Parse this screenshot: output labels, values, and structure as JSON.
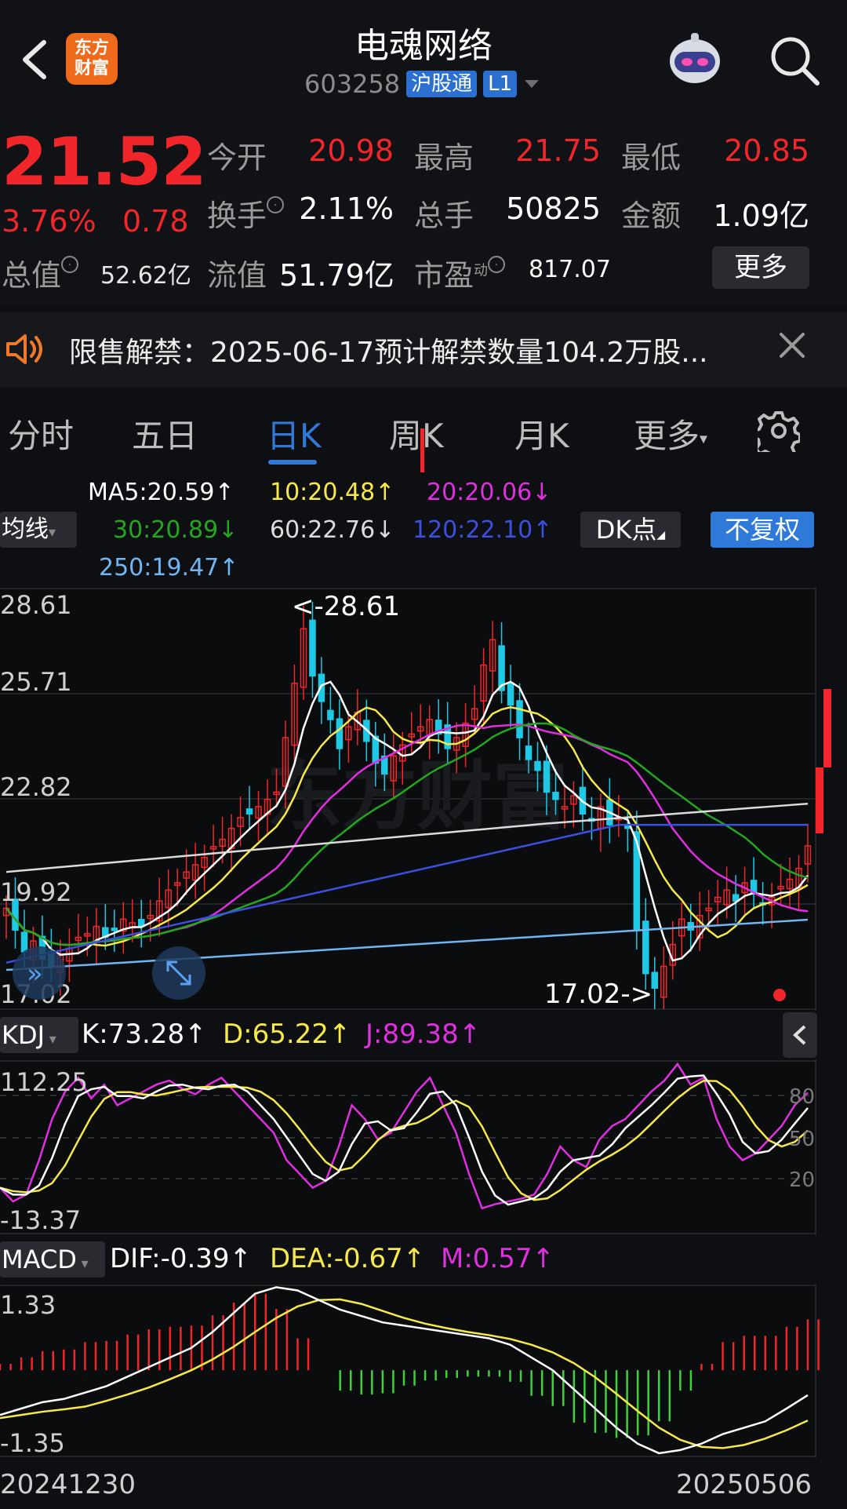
{
  "header": {
    "title": "电魂网络",
    "code": "603258",
    "exchange_tag": "沪股通",
    "level_tag": "L1",
    "logo_text_1": "东方",
    "logo_text_2": "财富"
  },
  "quote": {
    "price": "21.52",
    "change_pct": "3.76%",
    "change_amt": "0.78",
    "open_label": "今开",
    "open": "20.98",
    "high_label": "最高",
    "high": "21.75",
    "low_label": "最低",
    "low": "20.85",
    "turnover_label": "换手",
    "turnover": "2.11%",
    "volume_label": "总手",
    "volume": "50825",
    "amount_label": "金额",
    "amount": "1.09亿",
    "total_mv_label": "总值",
    "total_mv": "52.62亿",
    "float_mv_label": "流值",
    "float_mv": "51.79亿",
    "pe_label": "市盈",
    "pe_sup": "动",
    "pe": "817.07",
    "more_label": "更多"
  },
  "notice": {
    "text": "限售解禁：2025-06-17预计解禁数量104.2万股..."
  },
  "tabs": [
    "分时",
    "五日",
    "日K",
    "周K",
    "月K",
    "更多"
  ],
  "ma": {
    "ma5": "MA5:20.59↑",
    "ma10": "10:20.48↑",
    "ma20": "20:20.06↓",
    "ma30": "30:20.89↓",
    "ma60": "60:22.76↓",
    "ma120": "120:22.10↑",
    "ma250": "250:19.47↑",
    "dropdown": "均线",
    "dk_label": "DK点",
    "fq_label": "不复权"
  },
  "colors": {
    "up": "#f0262a",
    "down": "#1ec9e6",
    "ma5": "#ffffff",
    "ma10": "#f7e94a",
    "ma20": "#e02ee0",
    "ma30": "#23a71e",
    "ma60": "#dcdcdc",
    "ma120": "#3b4fe0",
    "ma250": "#6fb6f2"
  },
  "price_chart": {
    "y_labels": [
      "28.61",
      "25.71",
      "22.82",
      "19.92",
      "17.02"
    ],
    "max_note": "<-28.61",
    "min_note": "17.02->",
    "watermark": "东方财富"
  },
  "kdj": {
    "dropdown": "KDJ",
    "k": "K:73.28↑",
    "d": "D:65.22↑",
    "j": "J:89.38↑",
    "y_top": "112.25",
    "y_bottom": "-13.37",
    "levels": [
      "80",
      "50",
      "20"
    ]
  },
  "macd": {
    "dropdown": "MACD",
    "dif": "DIF:-0.39↑",
    "dea": "DEA:-0.67↑",
    "m": "M:0.57↑",
    "y_top": "1.33",
    "y_bottom": "-1.35"
  },
  "dates": {
    "start": "20241230",
    "end": "20250506"
  }
}
